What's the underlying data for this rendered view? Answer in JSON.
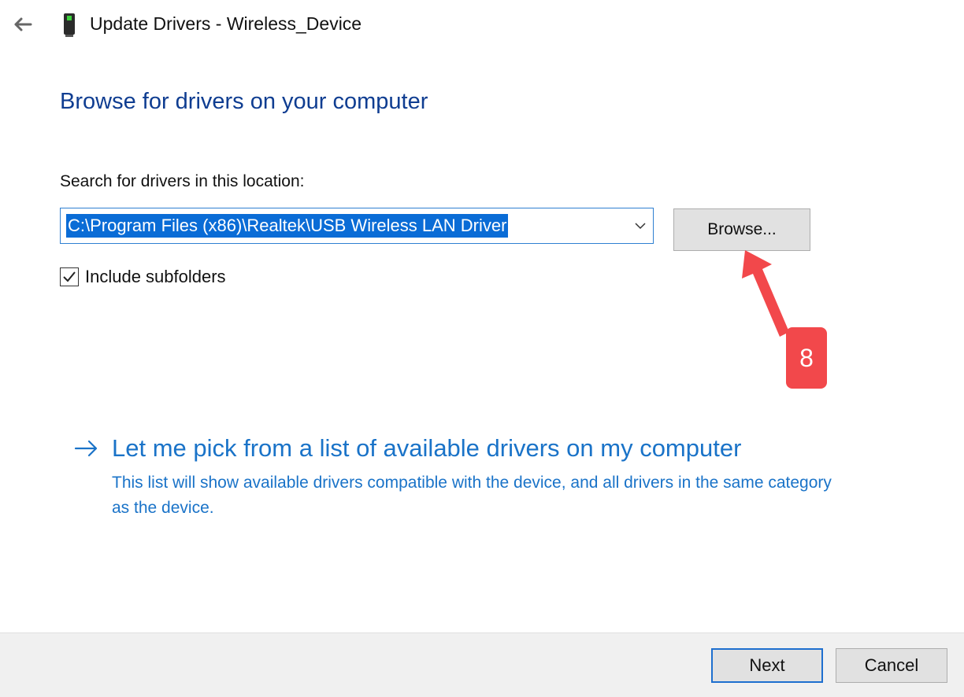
{
  "window": {
    "title": "Update Drivers - Wireless_Device",
    "back_icon": "back-arrow-icon",
    "device_icon": "wireless-device-icon"
  },
  "main": {
    "heading": "Browse for drivers on your computer",
    "search_label": "Search for drivers in this location:",
    "path_value": "C:\\Program Files (x86)\\Realtek\\USB Wireless LAN Driver",
    "browse_label": "Browse...",
    "include_subfolders": {
      "label": "Include subfolders",
      "checked": true
    }
  },
  "annotation": {
    "step_number": "8",
    "color": "#f2484b"
  },
  "pick_option": {
    "title": "Let me pick from a list of available drivers on my computer",
    "description": "This list will show available drivers compatible with the device, and all drivers in the same category as the device."
  },
  "footer": {
    "next_label": "Next",
    "cancel_label": "Cancel"
  },
  "colors": {
    "heading": "#0f3d91",
    "link": "#1a73c8",
    "selection": "#0a6cd6",
    "focus_border": "#1e6fcf"
  }
}
